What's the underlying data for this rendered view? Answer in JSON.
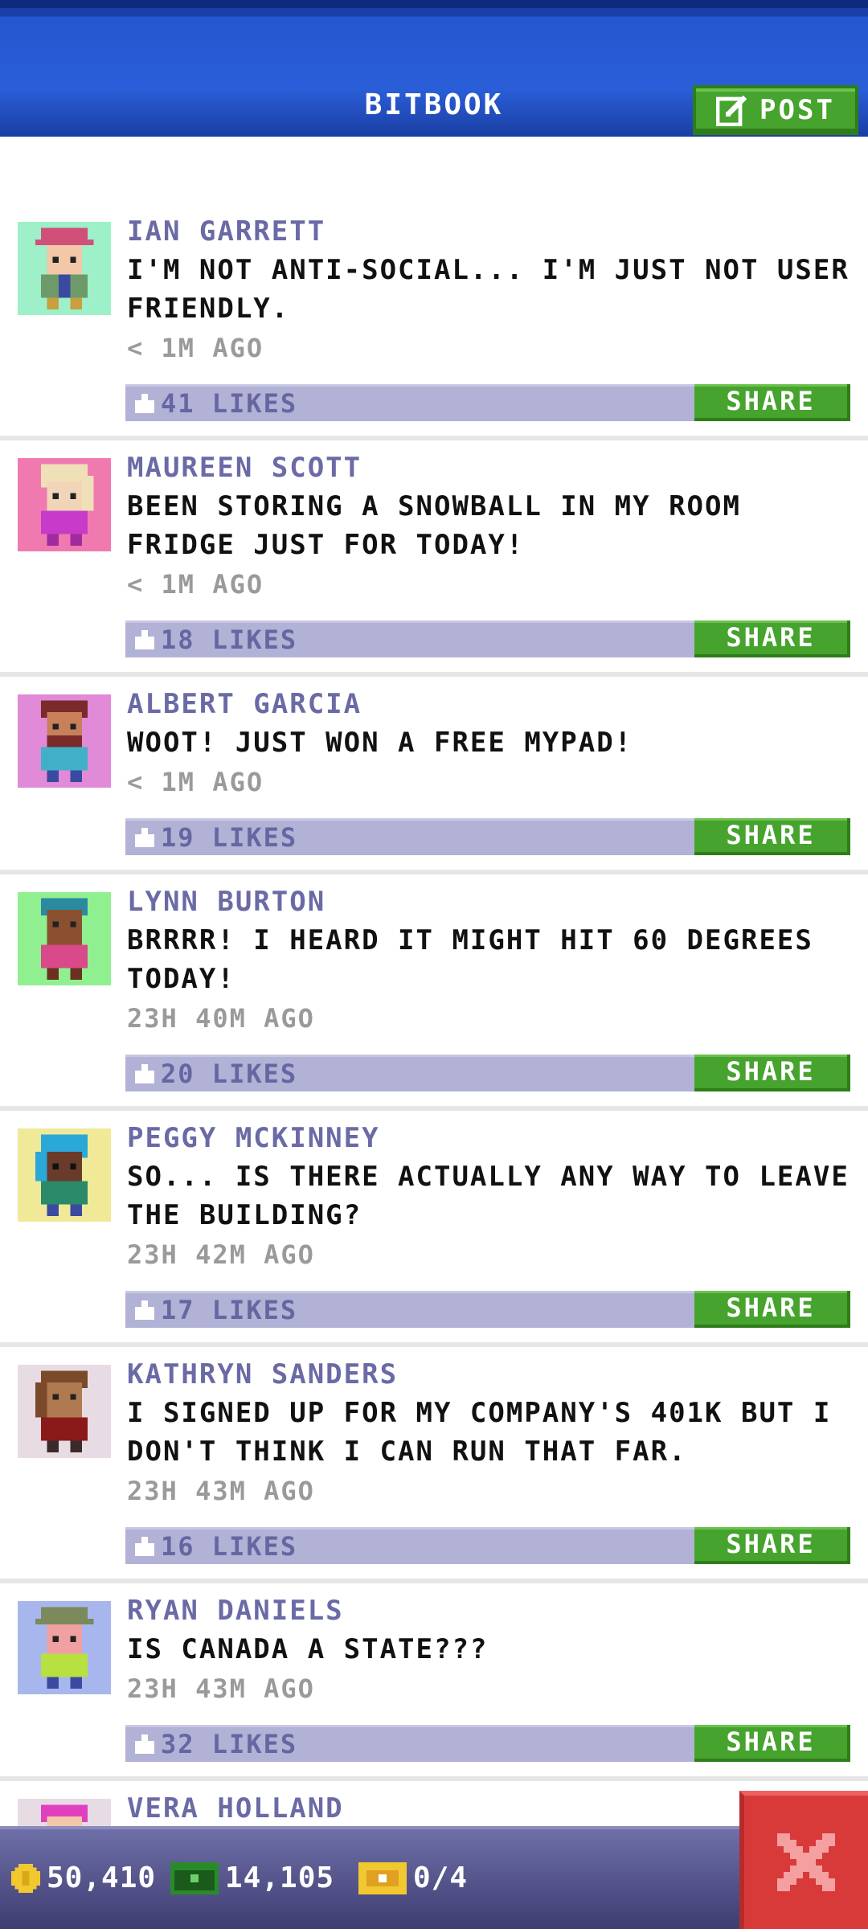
{
  "header": {
    "title": "BITBOOK",
    "post_label": "POST"
  },
  "posts": [
    {
      "name": "IAN GARRETT",
      "message": "I'M NOT ANTI-SOCIAL... I'M JUST NOT USER FRIENDLY.",
      "time": "< 1M AGO",
      "likes": "41 LIKES",
      "share": "SHARE",
      "avatar_bg": "#9ef0c8"
    },
    {
      "name": "MAUREEN SCOTT",
      "message": "BEEN STORING A SNOWBALL IN MY ROOM FRIDGE JUST FOR TODAY!",
      "time": "< 1M AGO",
      "likes": "18 LIKES",
      "share": "SHARE",
      "avatar_bg": "#f07ab0"
    },
    {
      "name": "ALBERT GARCIA",
      "message": "WOOT! JUST WON A FREE MYPAD!",
      "time": "< 1M AGO",
      "likes": "19 LIKES",
      "share": "SHARE",
      "avatar_bg": "#e08ad8"
    },
    {
      "name": "LYNN BURTON",
      "message": "BRRRR! I HEARD IT MIGHT HIT 60 DEGREES TODAY!",
      "time": "23H 40M AGO",
      "likes": "20 LIKES",
      "share": "SHARE",
      "avatar_bg": "#90f090"
    },
    {
      "name": "PEGGY MCKINNEY",
      "message": "SO... IS THERE ACTUALLY ANY WAY TO LEAVE THE BUILDING?",
      "time": "23H 42M AGO",
      "likes": "17 LIKES",
      "share": "SHARE",
      "avatar_bg": "#f0ea98"
    },
    {
      "name": "KATHRYN SANDERS",
      "message": "I SIGNED UP FOR MY COMPANY'S 401K BUT I DON'T THINK I CAN RUN THAT FAR.",
      "time": "23H 43M AGO",
      "likes": "16 LIKES",
      "share": "SHARE",
      "avatar_bg": "#e8dce4"
    },
    {
      "name": "RYAN DANIELS",
      "message": "IS CANADA A STATE???",
      "time": "23H 43M AGO",
      "likes": "32 LIKES",
      "share": "SHARE",
      "avatar_bg": "#a8b6ee"
    },
    {
      "name": "VERA HOLLAND",
      "message": "",
      "time": "",
      "likes": "",
      "share": "",
      "avatar_bg": "#e8dce4"
    }
  ],
  "bottom_bar": {
    "coins": "50,410",
    "bux": "14,105",
    "tickets": "0/4"
  },
  "colors": {
    "header_blue": "#2456cf",
    "share_green": "#46a32d",
    "likes_bar": "#b2b2d6",
    "name_purple": "#6a6aa6",
    "close_red": "#d83a3a"
  }
}
